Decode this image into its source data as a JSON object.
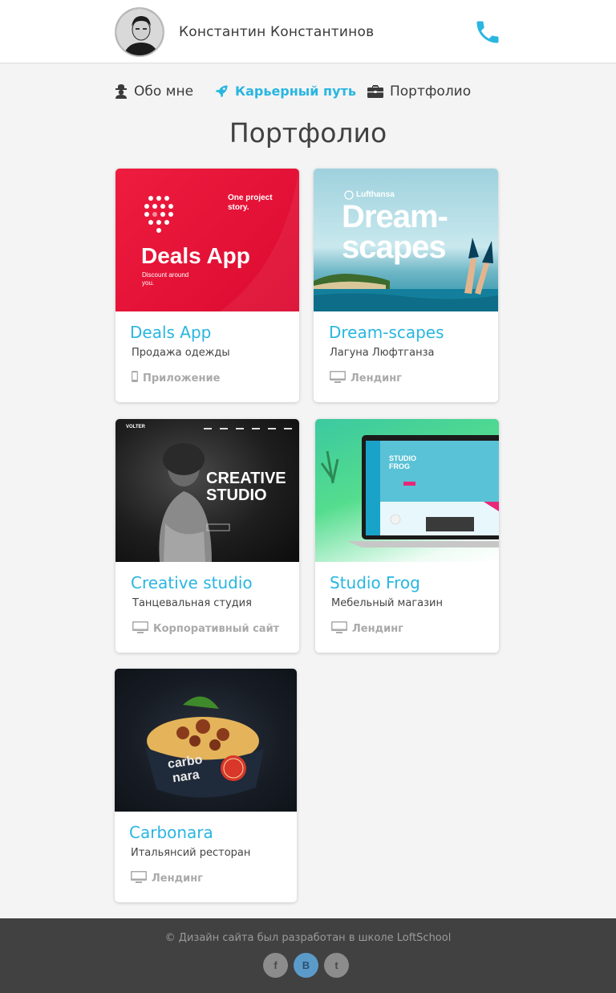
{
  "header": {
    "user_name": "Константин Константинов"
  },
  "nav": {
    "items": [
      {
        "label": "Обо мне",
        "icon": "user-icon"
      },
      {
        "label": "Карьерный путь",
        "icon": "rocket-icon",
        "active": true
      },
      {
        "label": "Портфолио",
        "icon": "briefcase-icon"
      }
    ]
  },
  "page_title": "Портфолио",
  "portfolio": [
    {
      "title": "Deals App",
      "description": "Продажа одежды",
      "type": "Приложение",
      "type_icon": "mobile-icon",
      "thumb": {
        "heading": "Deals App",
        "tagline": "One project story.",
        "sub": "Discount around you."
      }
    },
    {
      "title": "Dream-scapes",
      "description": "Лагуна Люфтганза",
      "type": "Лендинг",
      "type_icon": "desktop-icon",
      "thumb": {
        "brand": "Lufthansa",
        "heading_1": "Dream-",
        "heading_2": "scapes"
      }
    },
    {
      "title": "Creative studio",
      "description": "Танцевальная студия",
      "type": "Корпоративный сайт",
      "type_icon": "desktop-icon",
      "thumb": {
        "brand": "VOLTER",
        "heading_1": "CREATIVE",
        "heading_2": "STUDIO"
      }
    },
    {
      "title": "Studio Frog",
      "description": "Мебельный магазин",
      "type": "Лендинг",
      "type_icon": "desktop-icon",
      "thumb": {
        "heading_1": "STUDIO",
        "heading_2": "FROG"
      }
    },
    {
      "title": "Carbonara",
      "description": "Итальянсий ресторан",
      "type": "Лендинг",
      "type_icon": "desktop-icon",
      "thumb": {
        "heading_1": "carbo",
        "heading_2": "nara"
      }
    }
  ],
  "footer": {
    "copyright": "© Дизайн сайта был разработан в школе LoftSchool",
    "social": [
      {
        "label": "f",
        "icon": "facebook-icon"
      },
      {
        "label": "B",
        "icon": "vk-icon"
      },
      {
        "label": "t",
        "icon": "twitter-icon"
      }
    ]
  },
  "colors": {
    "accent": "#29b6e0",
    "footer_bg": "#414141",
    "page_bg": "#f4f4f4"
  }
}
